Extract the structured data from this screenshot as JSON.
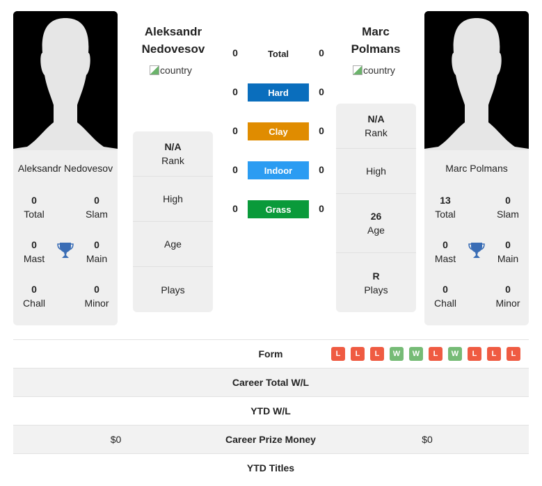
{
  "player1": {
    "header_name": [
      "Aleksandr",
      "Nedovesov"
    ],
    "card_name": "Aleksandr Nedovesov",
    "flag_alt": "country",
    "stats": {
      "total": {
        "value": "0",
        "label": "Total"
      },
      "slam": {
        "value": "0",
        "label": "Slam"
      },
      "mast": {
        "value": "0",
        "label": "Mast"
      },
      "main": {
        "value": "0",
        "label": "Main"
      },
      "chall": {
        "value": "0",
        "label": "Chall"
      },
      "minor": {
        "value": "0",
        "label": "Minor"
      }
    },
    "info": {
      "rank": {
        "value": "N/A",
        "label": "Rank"
      },
      "high": {
        "value": "",
        "label": "High"
      },
      "age": {
        "value": "",
        "label": "Age"
      },
      "plays": {
        "value": "",
        "label": "Plays"
      }
    }
  },
  "player2": {
    "header_name": [
      "Marc",
      "Polmans"
    ],
    "card_name": "Marc Polmans",
    "flag_alt": "country",
    "stats": {
      "total": {
        "value": "13",
        "label": "Total"
      },
      "slam": {
        "value": "0",
        "label": "Slam"
      },
      "mast": {
        "value": "0",
        "label": "Mast"
      },
      "main": {
        "value": "0",
        "label": "Main"
      },
      "chall": {
        "value": "0",
        "label": "Chall"
      },
      "minor": {
        "value": "0",
        "label": "Minor"
      }
    },
    "info": {
      "rank": {
        "value": "N/A",
        "label": "Rank"
      },
      "high": {
        "value": "",
        "label": "High"
      },
      "age": {
        "value": "26",
        "label": "Age"
      },
      "plays": {
        "value": "R",
        "label": "Plays"
      }
    }
  },
  "surfaces": [
    {
      "label": "Total",
      "left": "0",
      "right": "0",
      "color": ""
    },
    {
      "label": "Hard",
      "left": "0",
      "right": "0",
      "color": "#0a6ebd"
    },
    {
      "label": "Clay",
      "left": "0",
      "right": "0",
      "color": "#e08c00"
    },
    {
      "label": "Indoor",
      "left": "0",
      "right": "0",
      "color": "#2b9cf2"
    },
    {
      "label": "Grass",
      "left": "0",
      "right": "0",
      "color": "#0a9a3a"
    }
  ],
  "table": {
    "form_label": "Form",
    "form": [
      "L",
      "L",
      "L",
      "W",
      "W",
      "L",
      "W",
      "L",
      "L",
      "L"
    ],
    "form_colors": {
      "L": "#ef5b42",
      "W": "#76bb76"
    },
    "rows": [
      {
        "label": "Career Total W/L",
        "left": "",
        "right": ""
      },
      {
        "label": "YTD W/L",
        "left": "",
        "right": ""
      },
      {
        "label": "Career Prize Money",
        "left": "$0",
        "right": "$0"
      },
      {
        "label": "YTD Titles",
        "left": "",
        "right": ""
      }
    ]
  }
}
